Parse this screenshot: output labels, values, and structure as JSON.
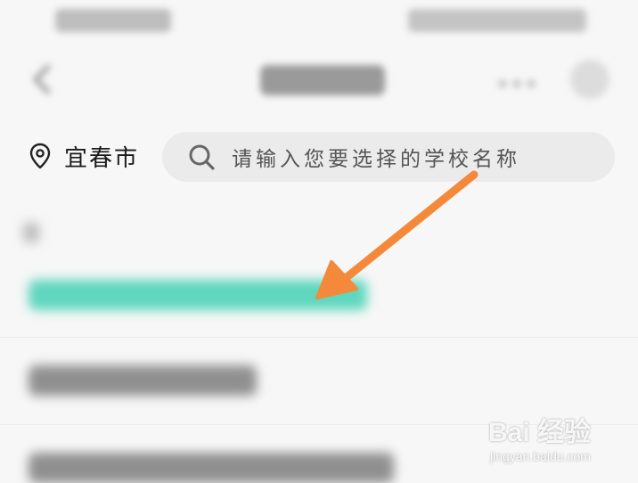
{
  "location": {
    "city": "宜春市"
  },
  "search": {
    "placeholder": "请输入您要选择的学校名称"
  },
  "colors": {
    "highlight": "#5fd6bd",
    "arrow": "#f5893a",
    "background": "#f7f7f7"
  },
  "icons": {
    "location": "map-pin-icon",
    "search": "magnifier-icon",
    "back": "chevron-left-icon"
  },
  "watermark": {
    "brand": "Bai 经验",
    "url": "jingyan.baidu.com"
  }
}
